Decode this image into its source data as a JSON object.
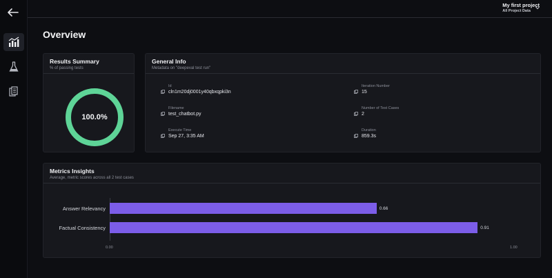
{
  "header": {
    "project_name": "My first project",
    "project_scope": "All Project Data"
  },
  "sidebar": {
    "items": [
      {
        "icon": "bar-chart-icon",
        "active": true
      },
      {
        "icon": "flask-icon",
        "active": false
      },
      {
        "icon": "documents-icon",
        "active": false
      }
    ]
  },
  "page": {
    "title": "Overview"
  },
  "results_summary": {
    "title": "Results Summary",
    "subtitle": "% of passing tests",
    "value_label": "100.0%",
    "pass_fraction": 1.0,
    "ring_color": "#5ed497"
  },
  "general_info": {
    "title": "General Info",
    "subtitle": "Metadata on \"deepeval test run\"",
    "fields": [
      {
        "label": "Id",
        "value": "cln1m20dj0001y40qbxqpki3n"
      },
      {
        "label": "Iteration Number",
        "value": "15"
      },
      {
        "label": "Filename",
        "value": "test_chatbot.py"
      },
      {
        "label": "Number of Test Cases",
        "value": "2"
      },
      {
        "label": "Execute Time",
        "value": "Sep 27, 3:35 AM"
      },
      {
        "label": "Duration",
        "value": "859.3s"
      }
    ]
  },
  "metrics": {
    "title": "Metrics Insights",
    "subtitle": "Average, metric scores across all 2 test cases"
  },
  "chart_data": {
    "type": "bar",
    "orientation": "horizontal",
    "categories": [
      "Answer Relevancy",
      "Factual Consistency"
    ],
    "values": [
      0.66,
      0.91
    ],
    "value_labels": [
      "0.66",
      "0.91"
    ],
    "xlim": [
      0,
      1
    ],
    "tick_labels": [
      "0.00",
      "1.00"
    ],
    "bar_color": "#7c5de8",
    "grid": false
  }
}
